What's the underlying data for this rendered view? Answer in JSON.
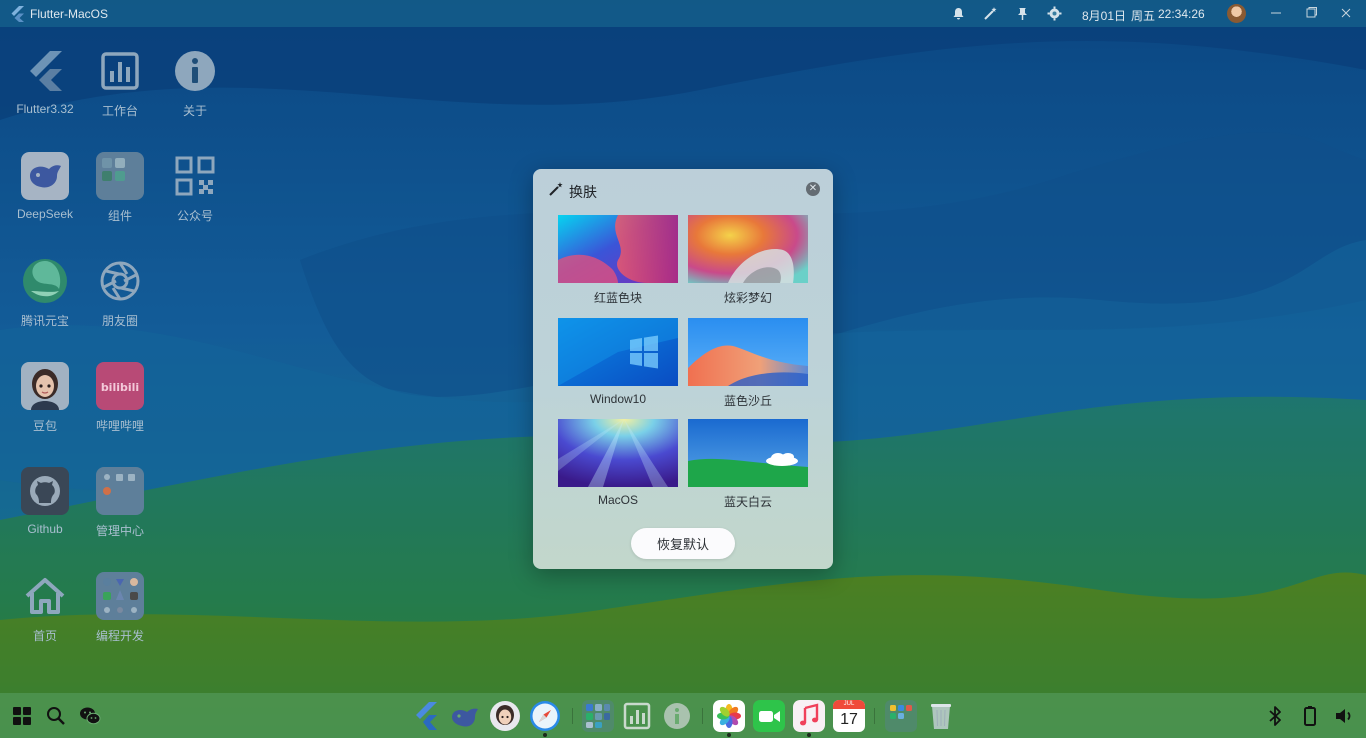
{
  "window": {
    "title": "Flutter-MacOS",
    "date": "8月01日",
    "weekday": "周五",
    "time": "22:34:26"
  },
  "topbar_icons": [
    "bell-icon",
    "magic-wand-icon",
    "pin-icon",
    "gear-icon"
  ],
  "desktop": {
    "items": [
      {
        "label": "Flutter3.32",
        "icon": "flutter-icon"
      },
      {
        "label": "工作台",
        "icon": "dashboard-icon"
      },
      {
        "label": "关于",
        "icon": "info-icon"
      },
      {
        "label": "DeepSeek",
        "icon": "deepseek-icon"
      },
      {
        "label": "组件",
        "icon": "folder-icon"
      },
      {
        "label": "公众号",
        "icon": "qrcode-icon"
      },
      {
        "label": "腾讯元宝",
        "icon": "yuanbao-icon"
      },
      {
        "label": "朋友圈",
        "icon": "camera-aperture-icon"
      },
      {
        "label": "豆包",
        "icon": "doubao-avatar-icon"
      },
      {
        "label": "哔哩哔哩",
        "icon": "bilibili-icon"
      },
      {
        "label": "Github",
        "icon": "github-icon"
      },
      {
        "label": "管理中心",
        "icon": "folder-icon"
      },
      {
        "label": "首页",
        "icon": "home-icon"
      },
      {
        "label": "编程开发",
        "icon": "folder-icon"
      }
    ]
  },
  "dialog": {
    "title": "换肤",
    "skins": [
      {
        "label": "红蓝色块"
      },
      {
        "label": "炫彩梦幻"
      },
      {
        "label": "Window10"
      },
      {
        "label": "蓝色沙丘"
      },
      {
        "label": "MacOS"
      },
      {
        "label": "蓝天白云"
      }
    ],
    "reset_label": "恢复默认"
  },
  "taskbar": {
    "calendar_month": "JUL",
    "calendar_day": "17",
    "left": [
      "windows-start-icon",
      "search-icon",
      "wechat-icon"
    ],
    "center": [
      "flutter-icon",
      "deepseek-icon",
      "doubao-avatar-icon",
      "safari-compass-icon",
      "folder-icon",
      "dashboard-icon",
      "info-icon",
      "photos-icon",
      "facetime-icon",
      "music-icon",
      "calendar-icon",
      "folder-icon",
      "trash-icon"
    ],
    "right": [
      "bluetooth-icon",
      "battery-icon",
      "volume-icon"
    ]
  },
  "colors": {
    "accent": "#1a5fa8",
    "dialog_bg": "#bdd3d8",
    "taskbar_bg": "#5aa064"
  }
}
